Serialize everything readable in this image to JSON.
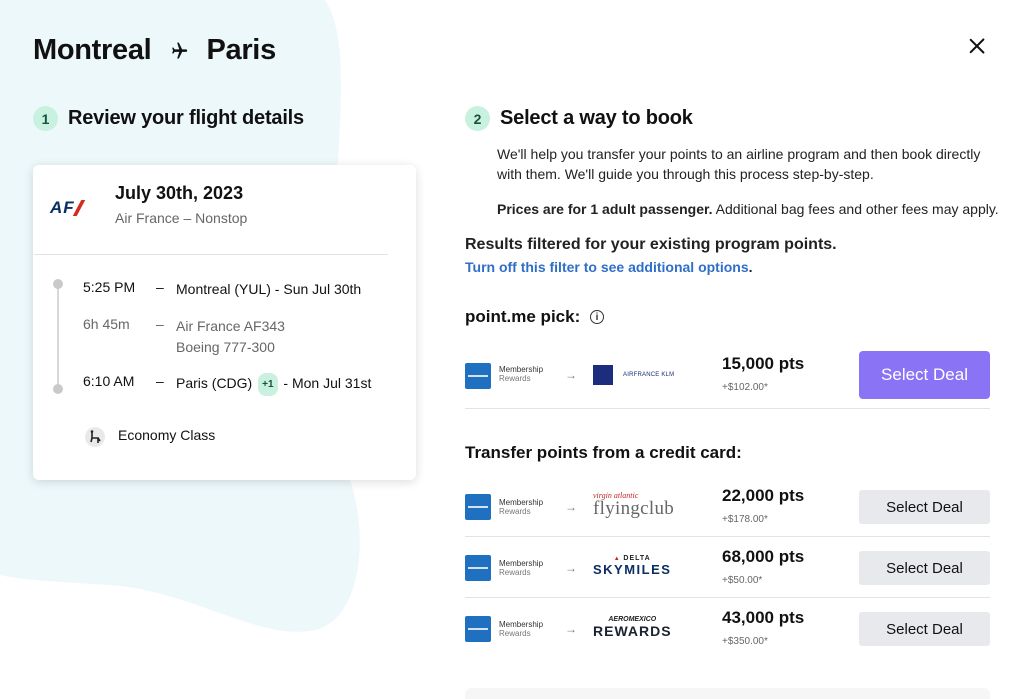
{
  "header": {
    "origin": "Montreal",
    "destination": "Paris"
  },
  "step1": {
    "number": "1",
    "title": "Review your flight details"
  },
  "flight": {
    "airline_logo_text": "AF",
    "date": "July 30th, 2023",
    "subtitle": "Air France – Nonstop",
    "departure": {
      "time": "5:25 PM",
      "dash": "–",
      "desc": "Montreal (YUL) - Sun Jul 30th"
    },
    "duration": {
      "time": "6h 45m",
      "dash": "–",
      "line1": "Air France AF343",
      "line2": "Boeing 777-300"
    },
    "arrival": {
      "time": "6:10 AM",
      "dash": "–",
      "desc_before": "Paris (CDG)",
      "badge": "+1",
      "desc_after": "- Mon Jul 31st"
    },
    "cabin": "Economy Class"
  },
  "step2": {
    "number": "2",
    "title": "Select a way to book",
    "intro_line1": "We'll help you transfer your points to an airline program and then book directly",
    "intro_line2": "with them. We'll guide you through this process step-by-step.",
    "prices_bold": "Prices are for 1 adult passenger.",
    "prices_rest": " Additional bag fees and other fees may apply."
  },
  "filter": {
    "heading": "Results filtered for your existing program points.",
    "link": "Turn off this filter to see additional options",
    "link_suffix": "."
  },
  "pick": {
    "title": "point.me pick:",
    "info_icon": "i",
    "source_name": "Membership",
    "source_sub": "Rewards",
    "arrow": "→",
    "partner_text": "AIRFRANCE KLM",
    "points": "15,000 pts",
    "fee": "+$102.00*",
    "button": "Select Deal"
  },
  "transfer": {
    "title": "Transfer points from a credit card:",
    "deals": [
      {
        "source_name": "Membership",
        "source_sub": "Rewards",
        "arrow": "→",
        "partner_top": "virgin atlantic",
        "partner_main": "flyingclub",
        "points": "22,000 pts",
        "fee": "+$178.00*",
        "button": "Select Deal"
      },
      {
        "source_name": "Membership",
        "source_sub": "Rewards",
        "arrow": "→",
        "partner_top": "DELTA",
        "partner_main": "SKYMILES",
        "points": "68,000 pts",
        "fee": "+$50.00*",
        "button": "Select Deal"
      },
      {
        "source_name": "Membership",
        "source_sub": "Rewards",
        "arrow": "→",
        "partner_top": "AEROMEXICO",
        "partner_main": "REWARDS",
        "points": "43,000 pts",
        "fee": "+$350.00*",
        "button": "Select Deal"
      }
    ]
  },
  "colors": {
    "accent_purple": "#8b73f5",
    "mint": "#c9f1df",
    "link_blue": "#2f6fc8",
    "amex_blue": "#1f70c1"
  }
}
